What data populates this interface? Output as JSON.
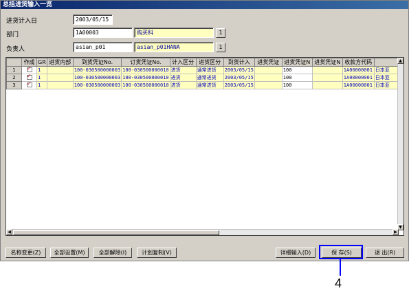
{
  "window": {
    "title": "总括进货输入一览"
  },
  "form": {
    "date_label": "进货计入日",
    "date_value": "2003/05/15",
    "dept_label": "部门",
    "dept_code": "1A00003",
    "dept_name": "购买科",
    "person_label": "负责人",
    "person_code": "asian_p01",
    "person_name": "asian_p01HANA",
    "search_button": "1"
  },
  "grid": {
    "columns": [
      "",
      "作成",
      "GR",
      "进货内部",
      "到货凭证No.",
      "订货凭证No.",
      "计入区分",
      "进货区分",
      "到货计入",
      "进货凭证",
      "进货凭证N",
      "进货凭证N",
      "收款方代码",
      ""
    ],
    "rows": [
      [
        "1",
        "",
        "1",
        "",
        "100-030500000003",
        "100-030500000010",
        "进货",
        "通常进货",
        "2003/05/15",
        "",
        "100",
        "",
        "1A00000001",
        "日本亚"
      ],
      [
        "2",
        "",
        "1",
        "",
        "100-030500000003",
        "100-030500000010",
        "进货",
        "通常进货",
        "2003/05/15",
        "",
        "100",
        "",
        "1A00000001",
        "日本亚"
      ],
      [
        "3",
        "",
        "1",
        "",
        "100-030500000003",
        "100-030500000010",
        "进货",
        "通常进货",
        "2003/05/15",
        "",
        "100",
        "",
        "1A00000001",
        "日本亚"
      ]
    ],
    "scroll_up": "▲",
    "scroll_down": "▼",
    "scroll_left": "◀",
    "scroll_right": "▶"
  },
  "buttons": {
    "rename": "名称变更(Z)",
    "set_all": "全部设置(M)",
    "clear_all": "全部解除(I)",
    "copy_plan": "计划复制(V)",
    "detail_input": "详细输入(D)",
    "save": "保 存(S)",
    "exit": "退 出(R)"
  },
  "annotation": {
    "callout": "4"
  },
  "colors": {
    "highlight": "#0000ff",
    "title_bar": "#0a246a",
    "yellow_field": "#ffffc0"
  }
}
